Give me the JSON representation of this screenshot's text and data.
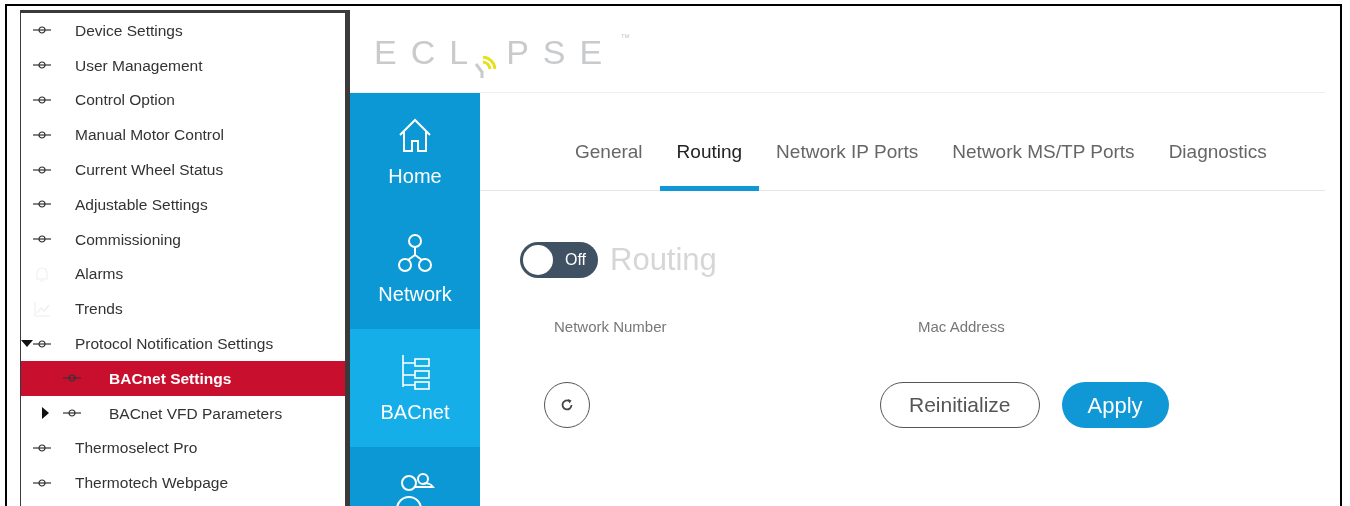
{
  "tree": [
    {
      "label": "Device Settings",
      "kind": "link",
      "selected": false
    },
    {
      "label": "User Management",
      "kind": "link",
      "selected": false
    },
    {
      "label": "Control Option",
      "kind": "link",
      "selected": false
    },
    {
      "label": "Manual Motor Control",
      "kind": "link",
      "selected": false
    },
    {
      "label": "Current Wheel Status",
      "kind": "link",
      "selected": false
    },
    {
      "label": "Adjustable Settings",
      "kind": "link",
      "selected": false
    },
    {
      "label": "Commissioning",
      "kind": "link",
      "selected": false
    },
    {
      "label": "Alarms",
      "kind": "bell",
      "selected": false
    },
    {
      "label": "Trends",
      "kind": "chart",
      "selected": false
    },
    {
      "label": "Protocol Notification Settings",
      "kind": "link",
      "selected": false,
      "expanded": true,
      "children": [
        {
          "label": "BACnet Settings",
          "kind": "link",
          "selected": true
        },
        {
          "label": "BACnet VFD Parameters",
          "kind": "link",
          "selected": false,
          "expanded": false
        }
      ]
    },
    {
      "label": "Thermoselect Pro",
      "kind": "link",
      "selected": false
    },
    {
      "label": "Thermotech Webpage",
      "kind": "link",
      "selected": false
    }
  ],
  "logo": {
    "left": "ECL",
    "right": "PSE",
    "mark": "™"
  },
  "nav": [
    {
      "label": "Home",
      "kind": "home",
      "selected": false
    },
    {
      "label": "Network",
      "kind": "network",
      "selected": false
    },
    {
      "label": "BACnet",
      "kind": "bacnet",
      "selected": true
    },
    {
      "kind": "users",
      "selected": false
    }
  ],
  "tabs": [
    {
      "label": "General",
      "selected": false
    },
    {
      "label": "Routing",
      "selected": true
    },
    {
      "label": "Network IP Ports",
      "selected": false
    },
    {
      "label": "Network MS/TP Ports",
      "selected": false
    },
    {
      "label": "Diagnostics",
      "selected": false
    }
  ],
  "routing": {
    "toggle": {
      "on": false,
      "label": "Off"
    },
    "title": "Routing",
    "fields": [
      "Network Number",
      "Mac Address"
    ]
  },
  "buttons": {
    "reinitialize": "Reinitialize",
    "apply": "Apply"
  }
}
